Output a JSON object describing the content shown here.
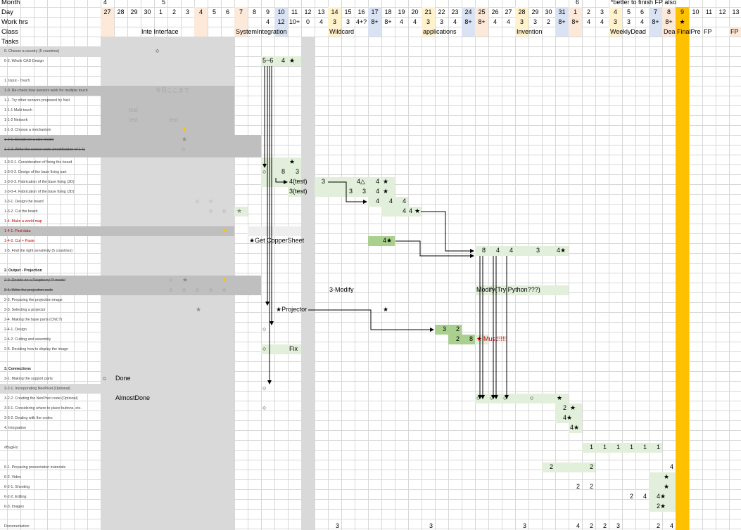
{
  "header": {
    "row_month_label": "Month",
    "row_day_label": "Day",
    "row_hours_label": "Work hrs",
    "row_class_label": "Class",
    "tasks_label": "Tasks",
    "month_markers": [
      "4",
      "5",
      "6"
    ],
    "note": "*better to finish FP also"
  },
  "days": [
    "27",
    "28",
    "29",
    "30",
    "1",
    "2",
    "3",
    "4",
    "5",
    "6",
    "7",
    "8",
    "9",
    "10",
    "11",
    "12",
    "13",
    "14",
    "15",
    "16",
    "17",
    "18",
    "19",
    "20",
    "21",
    "22",
    "23",
    "24",
    "25",
    "26",
    "27",
    "28",
    "29",
    "30",
    "31",
    "1",
    "2",
    "3",
    "4",
    "5",
    "6",
    "7",
    "8",
    "9",
    "10",
    "11",
    "12",
    "13"
  ],
  "hours": [
    "",
    "",
    "",
    "",
    "",
    "",
    "",
    "",
    "",
    "",
    "",
    "",
    "4",
    "12",
    "10+",
    "0",
    "4",
    "3",
    "3",
    "4+?",
    "8+",
    "8+",
    "4",
    "4",
    "3",
    "3",
    "4",
    "8+",
    "8+",
    "4",
    "4",
    "3",
    "3",
    "2",
    "8+",
    "8+",
    "4",
    "4",
    "3",
    "3",
    "4",
    "8+",
    "8+",
    "★",
    "",
    "",
    "",
    ""
  ],
  "classes": [
    {
      "label": "Inte Interface"
    },
    {
      "label": "SystemIntegration"
    },
    {
      "label": "Wildcard"
    },
    {
      "label": "applications"
    },
    {
      "label": "Invention"
    },
    {
      "label": "WeeklyDead"
    },
    {
      "label": "Dea"
    },
    {
      "label": "FinalPre"
    },
    {
      "label": "FP"
    },
    {
      "label": "FP"
    }
  ],
  "tasks": [
    {
      "label": "0. Choose a country (5 countries)"
    },
    {
      "label": "0-2. Whole CAD Design"
    },
    {
      "label": "1. Input - Touch"
    },
    {
      "label": "1-0. Re-check how sensors work for multiple touch"
    },
    {
      "label": "1-1. Try other sensors proposed by Neil"
    },
    {
      "label": "1-1-1 Multi-touch"
    },
    {
      "label": "1-1-2 Network"
    },
    {
      "label": "1-1-3. Choose a mechanism"
    },
    {
      "label": "1-2-1. Decide on a size model"
    },
    {
      "label": "1-2-2. Write the sensor code (modification of 1-1)"
    },
    {
      "label": "1-3-0-1. Consideration of fixing the board"
    },
    {
      "label": "1-3-0-2. Design of the base fixing part"
    },
    {
      "label": "1-3-0-3. Fabrication of the base fixing (2D)"
    },
    {
      "label": "1-3-0-4. Fabrication of the base fixing (3D)"
    },
    {
      "label": "1-3-1. Design the board"
    },
    {
      "label": "1-3-2. Cut the board"
    },
    {
      "label": "1-4. Make a world map"
    },
    {
      "label": "1-4-1. Find data"
    },
    {
      "label": "1-4-2. Cut + Paste"
    },
    {
      "label": "1-5. Find the right sensitivity (5 countries)"
    },
    {
      "label": "2. Output - Projection"
    },
    {
      "label": "2-0. Decide on a Raspberry Pi model"
    },
    {
      "label": "2-1. Write the projection code"
    },
    {
      "label": "2-2. Preparing the projection image"
    },
    {
      "label": "2-3. Selecting a projector"
    },
    {
      "label": "2-4. Making the base parts (CNC?)"
    },
    {
      "label": "2-4-1. Design"
    },
    {
      "label": "2-4-2. Cutting and assembly"
    },
    {
      "label": "2-5. Deciding how to display the image"
    },
    {
      "label": "3. Connections"
    },
    {
      "label": "3-1. Making the support parts"
    },
    {
      "label": "3-2-1. Incorporating NeoPixel (Optional)"
    },
    {
      "label": "3-2-2. Creating the NeoPixel code (Optional)"
    },
    {
      "label": "3-3-1. Considering where to place buttons, etc."
    },
    {
      "label": "3-3-2. Dealing with the codes"
    },
    {
      "label": "4. Integration"
    },
    {
      "label": "#BugFix"
    },
    {
      "label": "6-1. Preparing presentation materials"
    },
    {
      "label": "6-2. Video"
    },
    {
      "label": "6-2-1. Shooting"
    },
    {
      "label": "6-2-2. Editing"
    },
    {
      "label": "6-3. Images"
    },
    {
      "label": "Documentation"
    }
  ],
  "annotations": {
    "today_label": "今日ここまで",
    "test1": "test",
    "test2": "test",
    "test3": "test",
    "r_5_6": "5~6",
    "r_4a": "4",
    "r_8": "8",
    "r_3a": "3",
    "r_4test": "4(test)",
    "r_3test": "3(test)",
    "r_3b": "3",
    "r_4tri": "4△",
    "r_4b": "4",
    "r_3c": "3",
    "r_3d": "3",
    "r_4c": "4",
    "r_4d": "4",
    "r_4e": "4",
    "r_4f": "4",
    "r_4g": "4",
    "r_4h": "4",
    "r_get_copper": "★Get CopperSheet",
    "r_4i": "4★",
    "r_8b": "8",
    "r_4j": "4",
    "r_4k": "4",
    "r_3e": "3",
    "r_4star": "4★",
    "r_modify": "3-Modify",
    "r_modify_python": "Modify(Try Python???)",
    "r_projector": "★Projector",
    "r_3f": "3",
    "r_2a": "2",
    "r_2b": "2",
    "r_8c": "8",
    "r_must": "Must!!!!!!",
    "r_fix": "Fix",
    "legend_done": "Done",
    "legend_almost": "AlmostDone",
    "r_2c": "2",
    "r_2d": "2",
    "r_4star2": "4★",
    "r_4star3": "4★",
    "bugfix_values": [
      "1",
      "1",
      "1",
      "1",
      "1",
      "1"
    ],
    "r_2e": "2",
    "r_2f": "2",
    "r_4l": "4",
    "r_2g": "2",
    "r_2h": "2",
    "r_2i": "2",
    "r_4m": "4",
    "r_4n": "4★",
    "r_2star": "2★",
    "doc_values": [
      "3",
      "3",
      "3",
      "4",
      "2",
      "2",
      "3",
      "2",
      "4"
    ]
  },
  "colors": {
    "weekend": "#fde9d9",
    "weekday_blue": "#dae3f3",
    "yellow_col": "#ffc000",
    "grey_block": "#d9d9d9",
    "dark_grey": "#bfbfbf",
    "green_bar": "#e2efda",
    "green_dark": "#a9d08e",
    "star_gold": "#ffc000"
  }
}
